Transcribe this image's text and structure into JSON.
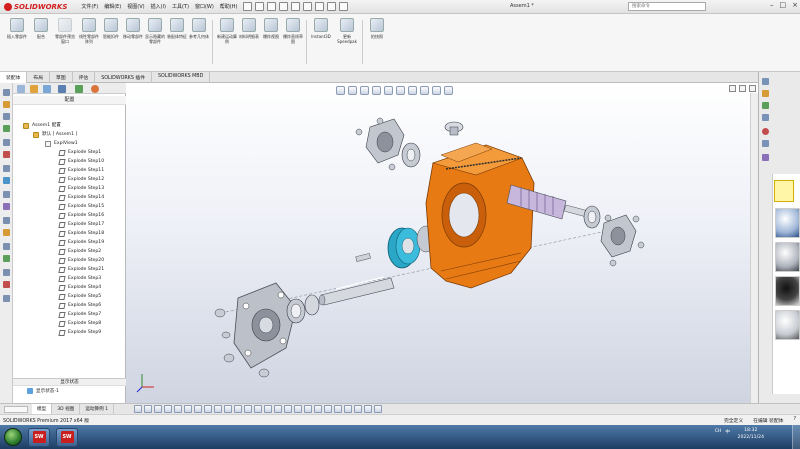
{
  "app": {
    "brand": "SOLIDWORKS",
    "document_title": "Assem1 *",
    "search_placeholder": "搜索命令",
    "menu": [
      "文件(F)",
      "编辑(E)",
      "视图(V)",
      "插入(I)",
      "工具(T)",
      "窗口(W)",
      "帮助(H)"
    ]
  },
  "command_manager": {
    "buttons": [
      {
        "label": "插入零部件",
        "icon": "insert-component-icon",
        "enabled": true
      },
      {
        "label": "配合",
        "icon": "mate-icon",
        "enabled": true
      },
      {
        "label": "零部件预览窗口",
        "icon": "component-preview-icon",
        "enabled": false
      },
      {
        "label": "线性零部件阵列",
        "icon": "linear-pattern-icon",
        "enabled": true
      },
      {
        "label": "智能扣件",
        "icon": "smart-fasteners-icon",
        "enabled": true
      },
      {
        "label": "移动零部件",
        "icon": "move-component-icon",
        "enabled": true
      },
      {
        "label": "显示隐藏的零部件",
        "icon": "show-hidden-icon",
        "enabled": true
      },
      {
        "label": "装配体特征",
        "icon": "assembly-features-icon",
        "enabled": true
      },
      {
        "label": "参考几何体",
        "icon": "reference-geometry-icon",
        "enabled": true
      },
      {
        "label": "新建运动算例",
        "icon": "new-motion-study-icon",
        "enabled": true
      },
      {
        "label": "材料明细表",
        "icon": "bom-icon",
        "enabled": true
      },
      {
        "label": "爆炸视图",
        "icon": "exploded-view-icon",
        "enabled": true
      },
      {
        "label": "爆炸直线草图",
        "icon": "explode-line-sketch-icon",
        "enabled": true
      },
      {
        "label": "Instant3D",
        "icon": "instant3d-icon",
        "enabled": true
      },
      {
        "label": "更新Speedpak",
        "icon": "speedpak-icon",
        "enabled": true
      },
      {
        "label": "拍快照",
        "icon": "snapshot-icon",
        "enabled": true
      }
    ],
    "tabs": [
      "装配体",
      "布局",
      "草图",
      "评估",
      "SOLIDWORKS 插件",
      "SOLIDWORKS MBD"
    ],
    "active_tab": 0
  },
  "feature_manager": {
    "header": "配置",
    "tree": [
      {
        "label": "Assem1 配置",
        "level": 0,
        "kind": "asm"
      },
      {
        "label": "默认 [ Assem1 ]",
        "level": 1,
        "kind": "asm"
      },
      {
        "label": "ExplView1",
        "level": 2,
        "kind": "folder"
      },
      {
        "label": "Explode Step1",
        "level": 3,
        "kind": "step"
      },
      {
        "label": "Explode Step10",
        "level": 3,
        "kind": "step"
      },
      {
        "label": "Explode Step11",
        "level": 3,
        "kind": "step"
      },
      {
        "label": "Explode Step12",
        "level": 3,
        "kind": "step"
      },
      {
        "label": "Explode Step13",
        "level": 3,
        "kind": "step"
      },
      {
        "label": "Explode Step14",
        "level": 3,
        "kind": "step"
      },
      {
        "label": "Explode Step15",
        "level": 3,
        "kind": "step"
      },
      {
        "label": "Explode Step16",
        "level": 3,
        "kind": "step"
      },
      {
        "label": "Explode Step17",
        "level": 3,
        "kind": "step"
      },
      {
        "label": "Explode Step18",
        "level": 3,
        "kind": "step"
      },
      {
        "label": "Explode Step19",
        "level": 3,
        "kind": "step"
      },
      {
        "label": "Explode Step2",
        "level": 3,
        "kind": "step"
      },
      {
        "label": "Explode Step20",
        "level": 3,
        "kind": "step"
      },
      {
        "label": "Explode Step21",
        "level": 3,
        "kind": "step"
      },
      {
        "label": "Explode Step3",
        "level": 3,
        "kind": "step"
      },
      {
        "label": "Explode Step4",
        "level": 3,
        "kind": "step"
      },
      {
        "label": "Explode Step5",
        "level": 3,
        "kind": "step"
      },
      {
        "label": "Explode Step6",
        "level": 3,
        "kind": "step"
      },
      {
        "label": "Explode Step7",
        "level": 3,
        "kind": "step"
      },
      {
        "label": "Explode Step8",
        "level": 3,
        "kind": "step"
      },
      {
        "label": "Explode Step9",
        "level": 3,
        "kind": "step"
      }
    ],
    "display_state_header": "显示状态",
    "display_state_item": "显示状态-1"
  },
  "bottom_tabs": [
    "模型",
    "3D 视图",
    "运动算例 1"
  ],
  "status_bar": {
    "left": "SOLIDWORKS Premium 2017 x64 版",
    "right": [
      "完全定义",
      "在编辑 装配体"
    ]
  },
  "taskbar": {
    "tray_left": [
      "CH",
      "中"
    ],
    "time": "18:32",
    "date": "2022/11/24"
  },
  "colors": {
    "housing": "#e87a14",
    "gear": "#2aa7c6",
    "steel": "#b8bcc6"
  }
}
